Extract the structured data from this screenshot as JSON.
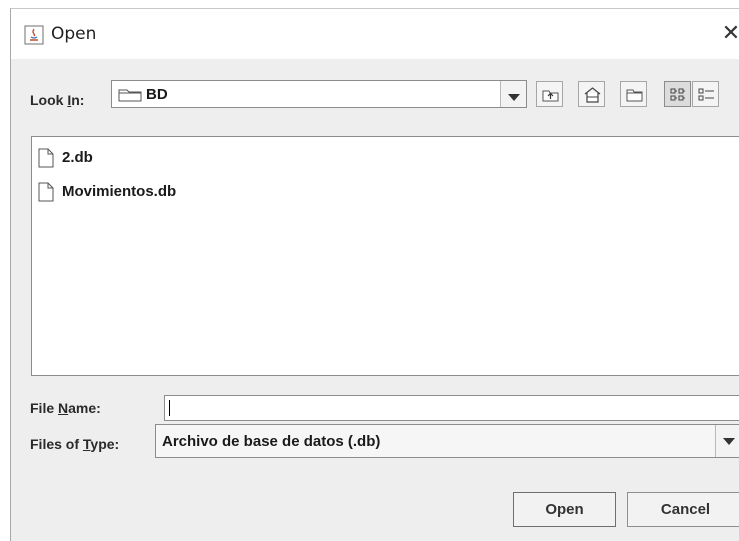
{
  "window": {
    "title": "Open",
    "close_glyph": "✕"
  },
  "look_in": {
    "label_pre": "Look ",
    "label_mnemonic": "I",
    "label_post": "n:",
    "value": "BD"
  },
  "toolbar": {
    "buttons": [
      {
        "icon": "up-one-level-icon"
      },
      {
        "icon": "home-icon"
      },
      {
        "icon": "new-folder-icon"
      },
      {
        "icon": "list-view-icon",
        "selected": true
      },
      {
        "icon": "details-view-icon"
      }
    ]
  },
  "files": [
    {
      "name": "2.db"
    },
    {
      "name": "Movimientos.db"
    }
  ],
  "file_name": {
    "label_pre": "File ",
    "label_mnemonic": "N",
    "label_post": "ame:",
    "value": ""
  },
  "file_type": {
    "label_pre": "Files of ",
    "label_mnemonic": "T",
    "label_post": "ype:",
    "value": "Archivo de base de datos (.db)"
  },
  "buttons": {
    "open": "Open",
    "cancel": "Cancel"
  }
}
